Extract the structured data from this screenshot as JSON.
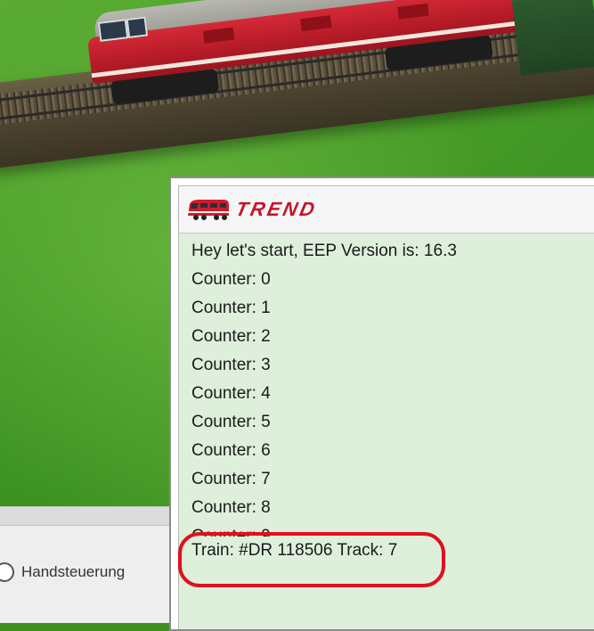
{
  "colors": {
    "log_background": "#def0dc",
    "highlight_ring": "#e0101c",
    "logo_red": "#c4142a"
  },
  "control_panel": {
    "mode_label": "Handsteuerung",
    "mode_icon": "radio-button"
  },
  "log_window": {
    "logo_icon": "train-icon",
    "logo_text": "TREND",
    "lines": [
      "Hey let's start, EEP Version is: 16.3",
      "Counter: 0",
      "Counter: 1",
      "Counter: 2",
      "Counter: 3",
      "Counter: 4",
      "Counter: 5",
      "Counter: 6",
      "Counter: 7",
      "Counter: 8",
      "Counter: 9"
    ],
    "highlighted_line": "Train: #DR 118506 Track: 7"
  }
}
